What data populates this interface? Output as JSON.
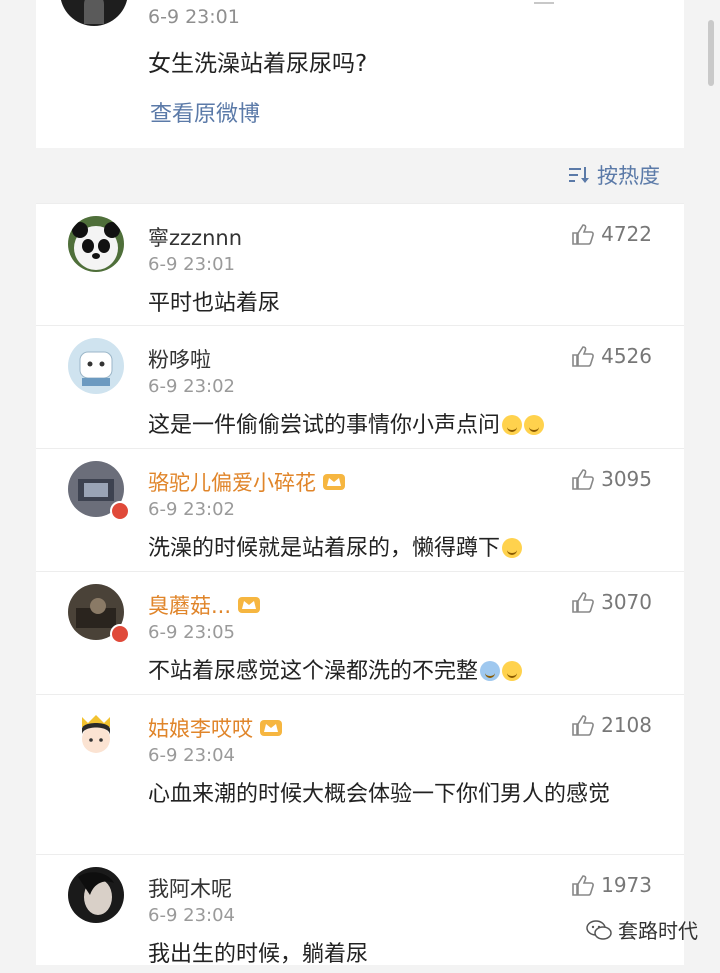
{
  "post": {
    "time": "6-9 23:01",
    "text": "女生洗澡站着尿尿吗?",
    "view_original": "查看原微博"
  },
  "sort": {
    "label": "按热度",
    "icon": "sort-icon"
  },
  "comments": [
    {
      "name": "寧zzznnn",
      "time": "6-9 23:01",
      "text": "平时也站着尿",
      "likes": "4722",
      "vip": false,
      "avatar": "panda-avatar"
    },
    {
      "name": "粉哆啦",
      "time": "6-9 23:02",
      "text": "这是一件偷偷尝试的事情你小声点问",
      "likes": "4526",
      "vip": false,
      "avatar": "cat-avatar",
      "emojis": 2
    },
    {
      "name": "骆驼儿偏爱小碎花",
      "time": "6-9 23:02",
      "text": "洗澡的时候就是站着尿的，懒得蹲下",
      "likes": "3095",
      "vip": true,
      "avatar": "photo-avatar",
      "emojis": 1
    },
    {
      "name": "臭蘑菇...",
      "time": "6-9 23:05",
      "text": "不站着尿感觉这个澡都洗的不完整",
      "likes": "3070",
      "vip": true,
      "avatar": "photo-avatar",
      "emojis": 2
    },
    {
      "name": "姑娘李哎哎",
      "time": "6-9 23:04",
      "text": "心血来潮的时候大概会体验一下你们男人的感觉",
      "likes": "2108",
      "vip": true,
      "avatar": "girl-avatar"
    },
    {
      "name": "我阿木呢",
      "time": "6-9 23:04",
      "text": "我出生的时候，躺着尿",
      "likes": "1973",
      "vip": false,
      "avatar": "face-avatar"
    }
  ],
  "watermark": {
    "text": "套路时代",
    "icon": "wechat-icon"
  },
  "colors": {
    "link": "#5b7aa8",
    "vip_name": "#e0852a",
    "background": "#f3f3f3"
  }
}
